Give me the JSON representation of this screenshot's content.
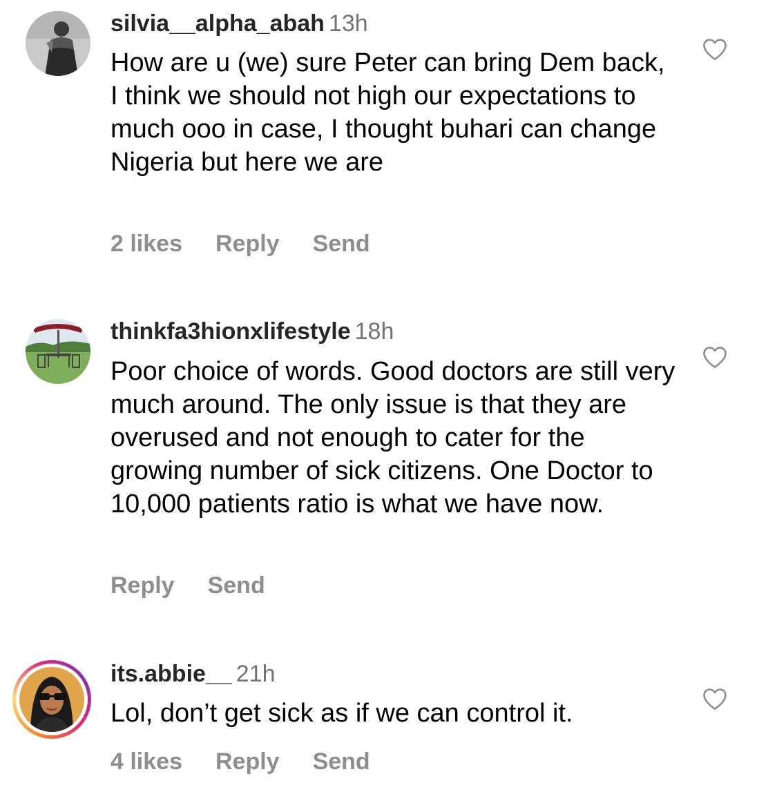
{
  "comments": [
    {
      "username": "silvia__alpha_abah",
      "time": "13h",
      "text": "How are u (we) sure Peter can bring Dem back, I think we should not high our expectations to much ooo in case, I thought buhari can change Nigeria but here we are",
      "likes": "2 likes",
      "reply": "Reply",
      "send": "Send",
      "avatar_icon": "profile-photo"
    },
    {
      "username": "thinkfa3hionxlifestyle",
      "time": "18h",
      "text": "Poor choice of words. Good doctors are still very much around. The only issue is that they are overused and not enough to cater for the growing number of sick citizens.  One Doctor to 10,000 patients ratio is what we have now.",
      "reply": "Reply",
      "send": "Send",
      "avatar_icon": "profile-photo"
    },
    {
      "username": "its.abbie__",
      "time": "21h",
      "text": "Lol, don’t get sick as if we can control it.",
      "likes": "4 likes",
      "reply": "Reply",
      "send": "Send",
      "avatar_icon": "profile-photo-with-story-ring"
    }
  ],
  "icons": {
    "like": "heart-outline-icon"
  },
  "colors": {
    "username": "#262626",
    "time": "#737373",
    "action": "#8e8e8e",
    "heart": "#8e8e8e"
  }
}
